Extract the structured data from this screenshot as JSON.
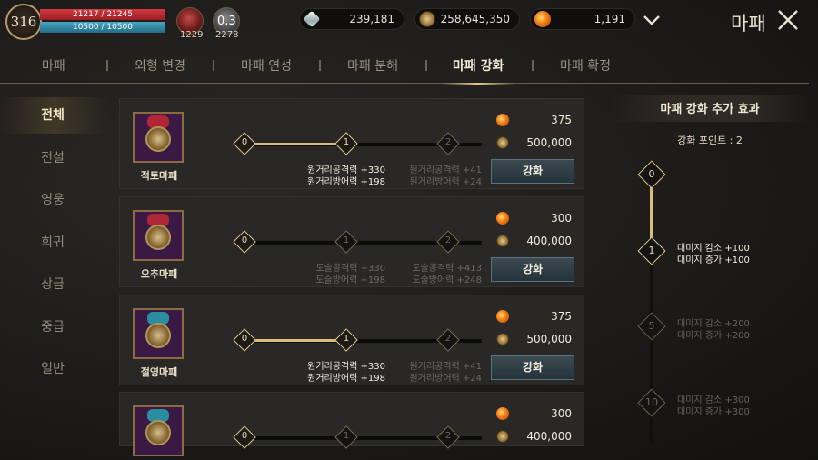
{
  "player": {
    "level": "316",
    "hp": "21217 / 21245",
    "mp": "10500 / 10500"
  },
  "potions": {
    "red_count": "1229",
    "gray_center": "0.3",
    "gray_count": "2278"
  },
  "currencies": [
    {
      "icon": "diamond-icon",
      "value": "239,181"
    },
    {
      "icon": "coin-icon",
      "value": "258,645,350"
    },
    {
      "icon": "orange-gem-icon",
      "value": "1,191"
    }
  ],
  "header": {
    "title": "마패"
  },
  "tabs": [
    {
      "label": "마패"
    },
    {
      "label": "외형 변경"
    },
    {
      "label": "마패 연성"
    },
    {
      "label": "마패 분해"
    },
    {
      "label": "마패 강화",
      "active": true
    },
    {
      "label": "마패 확정"
    }
  ],
  "left_nav": [
    {
      "label": "전체",
      "active": true
    },
    {
      "label": "전설"
    },
    {
      "label": "영웅"
    },
    {
      "label": "희귀"
    },
    {
      "label": "상급"
    },
    {
      "label": "중급"
    },
    {
      "label": "일반"
    }
  ],
  "cards": [
    {
      "name": "적토마패",
      "tassel_color": "#b02838",
      "nodes": [
        "0",
        "1",
        "2"
      ],
      "active_level": 1,
      "cost_gem": "375",
      "cost_coin": "500,000",
      "stat_current": "원거리공격력 +330\n원거리방어력 +198",
      "stat_next": "원거리공격력 +41\n원거리방어력 +24",
      "current_on": true,
      "button": "강화"
    },
    {
      "name": "오추마패",
      "tassel_color": "#b02838",
      "nodes": [
        "0",
        "1",
        "2"
      ],
      "active_level": 0,
      "cost_gem": "300",
      "cost_coin": "400,000",
      "stat_current": "도술공격력 +330\n도술방어력 +198",
      "stat_next": "도술공격력 +413\n도술방어력 +248",
      "current_on": false,
      "button": "강화"
    },
    {
      "name": "절영마패",
      "tassel_color": "#2a8ea0",
      "nodes": [
        "0",
        "1",
        "2"
      ],
      "active_level": 1,
      "cost_gem": "375",
      "cost_coin": "500,000",
      "stat_current": "원거리공격력 +330\n원거리방어력 +198",
      "stat_next": "원거리공격력 +41\n원거리방어력 +24",
      "current_on": true,
      "button": "강화"
    },
    {
      "name": "",
      "tassel_color": "#2a8ea0",
      "nodes": [
        "0",
        "1",
        "2"
      ],
      "active_level": 0,
      "cost_gem": "300",
      "cost_coin": "400,000",
      "stat_current": "",
      "stat_next": "",
      "current_on": false,
      "button": ""
    }
  ],
  "right_panel": {
    "title": "마패 강화 추가 효과",
    "points": "강화 포인트 : 2",
    "milestones": [
      {
        "label": "0",
        "on": true,
        "effects": ""
      },
      {
        "label": "1",
        "on": true,
        "effects": "대미지 감소 +100\n대미지 증가 +100"
      },
      {
        "label": "5",
        "on": false,
        "effects": "대미지 감소 +200\n대미지 증가 +200"
      },
      {
        "label": "10",
        "on": false,
        "effects": "대미지 감소 +300\n대미지 증가 +300"
      }
    ]
  }
}
